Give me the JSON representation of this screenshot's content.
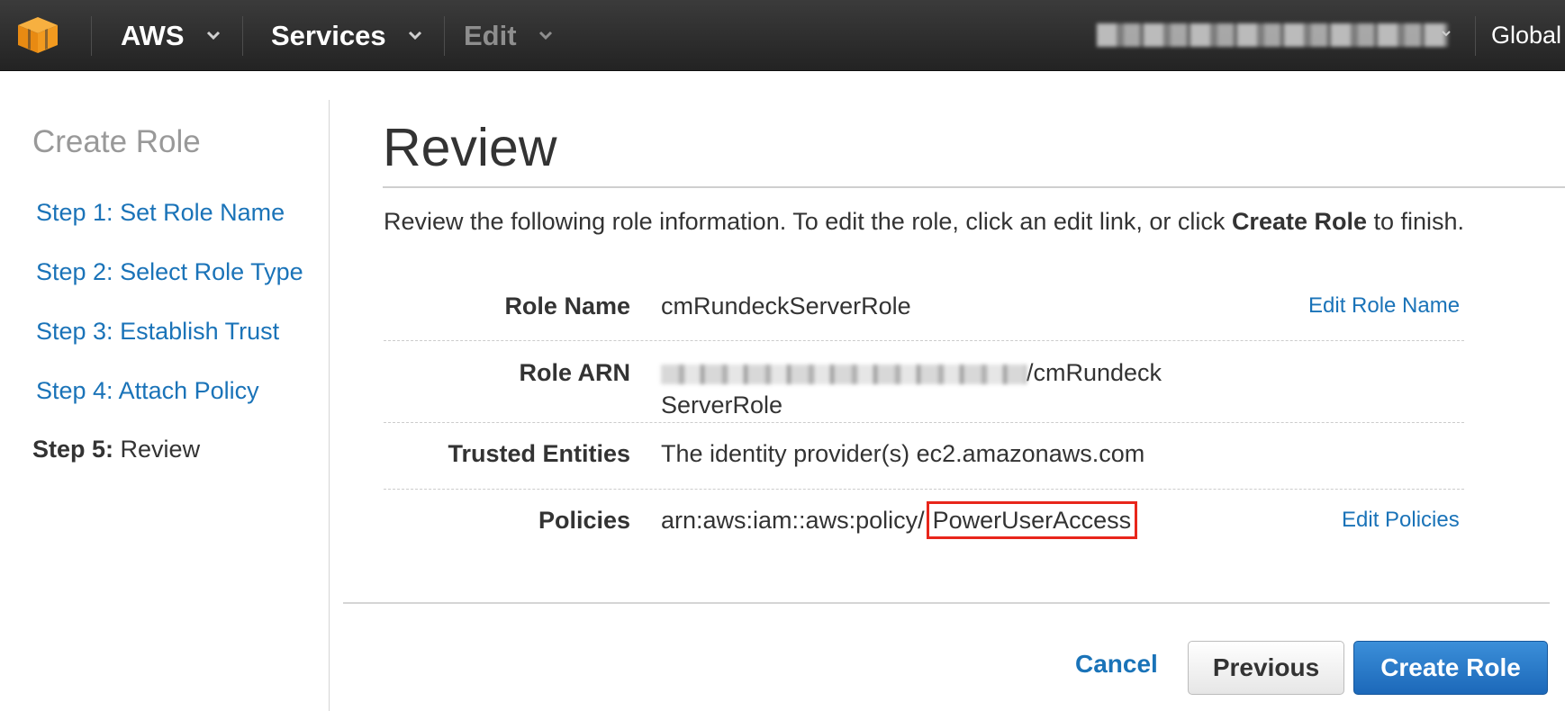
{
  "topbar": {
    "brand_label": "AWS",
    "services_label": "Services",
    "edit_label": "Edit",
    "region_label": "Global",
    "icons": [
      "aws-cube-icon",
      "chevron-down-icon"
    ]
  },
  "sidebar": {
    "title": "Create Role",
    "steps": [
      {
        "label": "Step 1: Set Role Name"
      },
      {
        "label": "Step 2: Select Role Type"
      },
      {
        "label": "Step 3: Establish Trust"
      },
      {
        "label": "Step 4: Attach Policy"
      }
    ],
    "current_step": {
      "prefix": "Step 5:",
      "label": "Review"
    }
  },
  "main": {
    "title": "Review",
    "intro_before": "Review the following role information. To edit the role, click an edit link, or click ",
    "intro_bold": "Create Role",
    "intro_after": " to finish.",
    "rows": {
      "role_name": {
        "label": "Role Name",
        "value": "cmRundeckServerRole",
        "edit": "Edit Role Name"
      },
      "role_arn": {
        "label": "Role ARN",
        "value_suffix_line1": "/cmRundeck",
        "value_line2": "ServerRole"
      },
      "trusted": {
        "label": "Trusted Entities",
        "value": "The identity provider(s) ec2.amazonaws.com"
      },
      "policies": {
        "label": "Policies",
        "value_prefix": "arn:aws:iam::aws:policy/",
        "value_highlight": "PowerUserAccess",
        "edit": "Edit Policies"
      }
    }
  },
  "footer": {
    "cancel_label": "Cancel",
    "previous_label": "Previous",
    "create_label": "Create Role"
  },
  "colors": {
    "link": "#1a73b8",
    "primary_button": "#1c68b9",
    "highlight_border": "#e8261b",
    "aws_orange": "#f29a1f"
  }
}
